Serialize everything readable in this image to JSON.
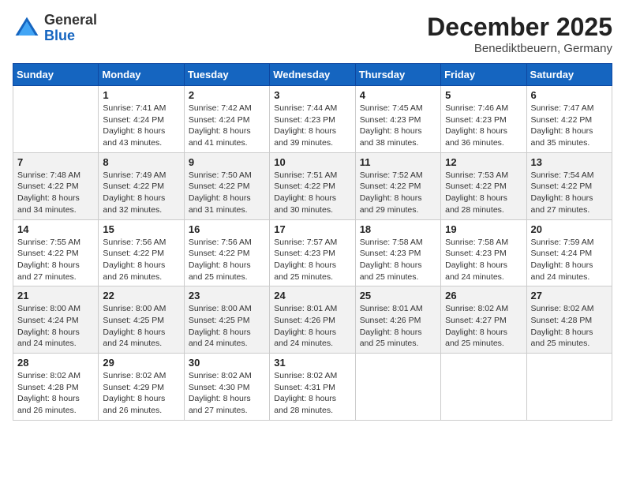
{
  "header": {
    "logo_general": "General",
    "logo_blue": "Blue",
    "month_title": "December 2025",
    "location": "Benediktbeuern, Germany"
  },
  "weekdays": [
    "Sunday",
    "Monday",
    "Tuesday",
    "Wednesday",
    "Thursday",
    "Friday",
    "Saturday"
  ],
  "weeks": [
    [
      {
        "day": "",
        "sunrise": "",
        "sunset": "",
        "daylight": ""
      },
      {
        "day": "1",
        "sunrise": "Sunrise: 7:41 AM",
        "sunset": "Sunset: 4:24 PM",
        "daylight": "Daylight: 8 hours and 43 minutes."
      },
      {
        "day": "2",
        "sunrise": "Sunrise: 7:42 AM",
        "sunset": "Sunset: 4:24 PM",
        "daylight": "Daylight: 8 hours and 41 minutes."
      },
      {
        "day": "3",
        "sunrise": "Sunrise: 7:44 AM",
        "sunset": "Sunset: 4:23 PM",
        "daylight": "Daylight: 8 hours and 39 minutes."
      },
      {
        "day": "4",
        "sunrise": "Sunrise: 7:45 AM",
        "sunset": "Sunset: 4:23 PM",
        "daylight": "Daylight: 8 hours and 38 minutes."
      },
      {
        "day": "5",
        "sunrise": "Sunrise: 7:46 AM",
        "sunset": "Sunset: 4:23 PM",
        "daylight": "Daylight: 8 hours and 36 minutes."
      },
      {
        "day": "6",
        "sunrise": "Sunrise: 7:47 AM",
        "sunset": "Sunset: 4:22 PM",
        "daylight": "Daylight: 8 hours and 35 minutes."
      }
    ],
    [
      {
        "day": "7",
        "sunrise": "Sunrise: 7:48 AM",
        "sunset": "Sunset: 4:22 PM",
        "daylight": "Daylight: 8 hours and 34 minutes."
      },
      {
        "day": "8",
        "sunrise": "Sunrise: 7:49 AM",
        "sunset": "Sunset: 4:22 PM",
        "daylight": "Daylight: 8 hours and 32 minutes."
      },
      {
        "day": "9",
        "sunrise": "Sunrise: 7:50 AM",
        "sunset": "Sunset: 4:22 PM",
        "daylight": "Daylight: 8 hours and 31 minutes."
      },
      {
        "day": "10",
        "sunrise": "Sunrise: 7:51 AM",
        "sunset": "Sunset: 4:22 PM",
        "daylight": "Daylight: 8 hours and 30 minutes."
      },
      {
        "day": "11",
        "sunrise": "Sunrise: 7:52 AM",
        "sunset": "Sunset: 4:22 PM",
        "daylight": "Daylight: 8 hours and 29 minutes."
      },
      {
        "day": "12",
        "sunrise": "Sunrise: 7:53 AM",
        "sunset": "Sunset: 4:22 PM",
        "daylight": "Daylight: 8 hours and 28 minutes."
      },
      {
        "day": "13",
        "sunrise": "Sunrise: 7:54 AM",
        "sunset": "Sunset: 4:22 PM",
        "daylight": "Daylight: 8 hours and 27 minutes."
      }
    ],
    [
      {
        "day": "14",
        "sunrise": "Sunrise: 7:55 AM",
        "sunset": "Sunset: 4:22 PM",
        "daylight": "Daylight: 8 hours and 27 minutes."
      },
      {
        "day": "15",
        "sunrise": "Sunrise: 7:56 AM",
        "sunset": "Sunset: 4:22 PM",
        "daylight": "Daylight: 8 hours and 26 minutes."
      },
      {
        "day": "16",
        "sunrise": "Sunrise: 7:56 AM",
        "sunset": "Sunset: 4:22 PM",
        "daylight": "Daylight: 8 hours and 25 minutes."
      },
      {
        "day": "17",
        "sunrise": "Sunrise: 7:57 AM",
        "sunset": "Sunset: 4:23 PM",
        "daylight": "Daylight: 8 hours and 25 minutes."
      },
      {
        "day": "18",
        "sunrise": "Sunrise: 7:58 AM",
        "sunset": "Sunset: 4:23 PM",
        "daylight": "Daylight: 8 hours and 25 minutes."
      },
      {
        "day": "19",
        "sunrise": "Sunrise: 7:58 AM",
        "sunset": "Sunset: 4:23 PM",
        "daylight": "Daylight: 8 hours and 24 minutes."
      },
      {
        "day": "20",
        "sunrise": "Sunrise: 7:59 AM",
        "sunset": "Sunset: 4:24 PM",
        "daylight": "Daylight: 8 hours and 24 minutes."
      }
    ],
    [
      {
        "day": "21",
        "sunrise": "Sunrise: 8:00 AM",
        "sunset": "Sunset: 4:24 PM",
        "daylight": "Daylight: 8 hours and 24 minutes."
      },
      {
        "day": "22",
        "sunrise": "Sunrise: 8:00 AM",
        "sunset": "Sunset: 4:25 PM",
        "daylight": "Daylight: 8 hours and 24 minutes."
      },
      {
        "day": "23",
        "sunrise": "Sunrise: 8:00 AM",
        "sunset": "Sunset: 4:25 PM",
        "daylight": "Daylight: 8 hours and 24 minutes."
      },
      {
        "day": "24",
        "sunrise": "Sunrise: 8:01 AM",
        "sunset": "Sunset: 4:26 PM",
        "daylight": "Daylight: 8 hours and 24 minutes."
      },
      {
        "day": "25",
        "sunrise": "Sunrise: 8:01 AM",
        "sunset": "Sunset: 4:26 PM",
        "daylight": "Daylight: 8 hours and 25 minutes."
      },
      {
        "day": "26",
        "sunrise": "Sunrise: 8:02 AM",
        "sunset": "Sunset: 4:27 PM",
        "daylight": "Daylight: 8 hours and 25 minutes."
      },
      {
        "day": "27",
        "sunrise": "Sunrise: 8:02 AM",
        "sunset": "Sunset: 4:28 PM",
        "daylight": "Daylight: 8 hours and 25 minutes."
      }
    ],
    [
      {
        "day": "28",
        "sunrise": "Sunrise: 8:02 AM",
        "sunset": "Sunset: 4:28 PM",
        "daylight": "Daylight: 8 hours and 26 minutes."
      },
      {
        "day": "29",
        "sunrise": "Sunrise: 8:02 AM",
        "sunset": "Sunset: 4:29 PM",
        "daylight": "Daylight: 8 hours and 26 minutes."
      },
      {
        "day": "30",
        "sunrise": "Sunrise: 8:02 AM",
        "sunset": "Sunset: 4:30 PM",
        "daylight": "Daylight: 8 hours and 27 minutes."
      },
      {
        "day": "31",
        "sunrise": "Sunrise: 8:02 AM",
        "sunset": "Sunset: 4:31 PM",
        "daylight": "Daylight: 8 hours and 28 minutes."
      },
      {
        "day": "",
        "sunrise": "",
        "sunset": "",
        "daylight": ""
      },
      {
        "day": "",
        "sunrise": "",
        "sunset": "",
        "daylight": ""
      },
      {
        "day": "",
        "sunrise": "",
        "sunset": "",
        "daylight": ""
      }
    ]
  ]
}
